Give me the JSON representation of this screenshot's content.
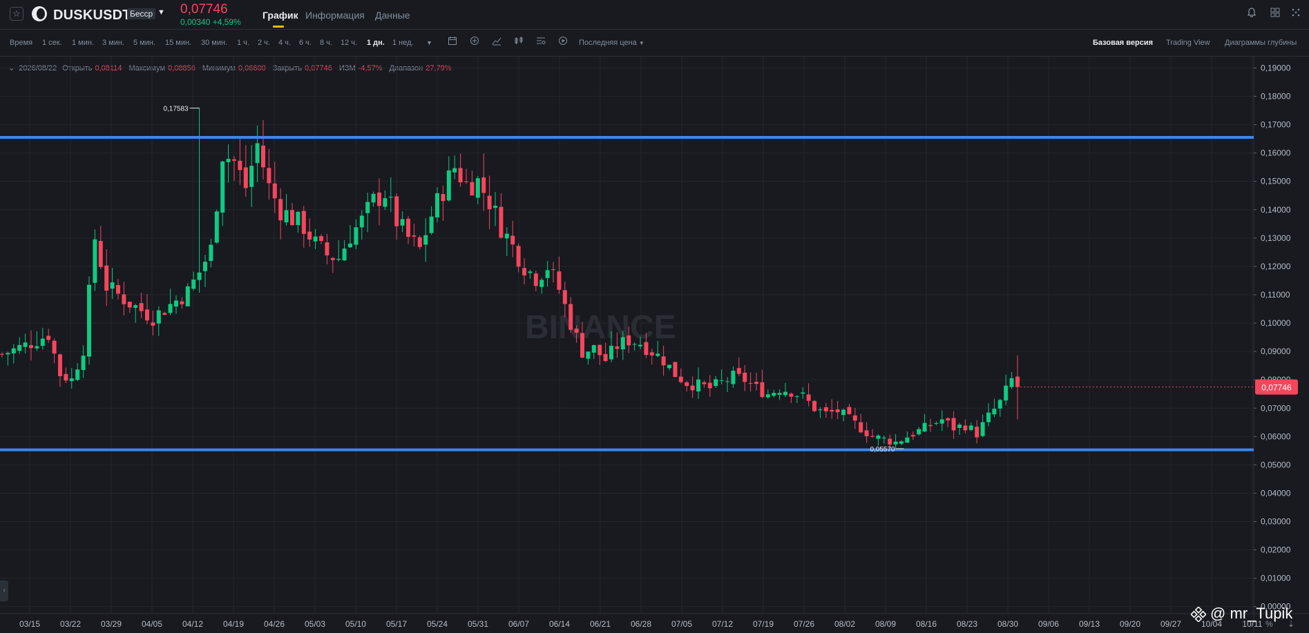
{
  "header": {
    "symbol": "DUSKUSDT",
    "contract_type": "Бесср",
    "last_price": "0,07746",
    "change": "0,00340 +4,59%",
    "tabs": [
      {
        "label": "График",
        "active": true
      },
      {
        "label": "Информация",
        "active": false
      },
      {
        "label": "Данные",
        "active": false
      }
    ],
    "icons": [
      "star-icon",
      "bell-icon",
      "grid-icon",
      "more-icon"
    ]
  },
  "toolbar": {
    "time_label": "Время",
    "timeframes": [
      "1 сек.",
      "1 мин.",
      "3 мин.",
      "5 мин.",
      "15 мин.",
      "30 мин.",
      "1 ч.",
      "2 ч.",
      "4 ч.",
      "6 ч.",
      "8 ч.",
      "12 ч.",
      "1 дн.",
      "1 нед."
    ],
    "active_timeframe": "1 дн.",
    "price_type": "Последняя цена",
    "views": [
      "Базовая версия",
      "Trading View",
      "Диаграммы глубины"
    ],
    "active_view": "Базовая версия"
  },
  "ohlc": {
    "date": "2026/08/22",
    "open_label": "Открыть",
    "open": "0,08114",
    "high_label": "Максимум",
    "high": "0,08856",
    "low_label": "Минимум",
    "low": "0,06600",
    "close_label": "Закрыть",
    "close": "0,07746",
    "change_label": "ИЗМ",
    "change": "-4,57%",
    "range_label": "Диапазон",
    "range": "27,79%"
  },
  "chart_data": {
    "type": "candlestick",
    "x_ticks": [
      "03/15",
      "03/22",
      "03/29",
      "04/05",
      "04/12",
      "04/19",
      "04/26",
      "05/03",
      "05/10",
      "05/17",
      "05/24",
      "05/31",
      "06/07",
      "06/14",
      "06/21",
      "06/28",
      "07/05",
      "07/12",
      "07/19",
      "07/26",
      "08/02",
      "08/09",
      "08/16",
      "08/23",
      "08/30",
      "09/06",
      "09/13",
      "09/20",
      "09/27",
      "10/04",
      "10/11"
    ],
    "y_ticks": [
      "0,19000",
      "0,18000",
      "0,17000",
      "0,16000",
      "0,15000",
      "0,14000",
      "0,13000",
      "0,12000",
      "0,11000",
      "0,10000",
      "0,09000",
      "0,08000",
      "0,07000",
      "0,06000",
      "0,05000",
      "0,04000",
      "0,03000",
      "0,02000",
      "0,01000",
      "0,00000"
    ],
    "y_values": [
      0.19,
      0.18,
      0.17,
      0.16,
      0.15,
      0.14,
      0.13,
      0.12,
      0.11,
      0.1,
      0.09,
      0.08,
      0.07,
      0.06,
      0.05,
      0.04,
      0.03,
      0.02,
      0.01,
      0.0
    ],
    "ylim": [
      -0.0025,
      0.194
    ],
    "first_candle_day": 0,
    "last_candle_day": 162,
    "up_color": "#0ecb81",
    "down_color": "#f6465d",
    "close_points": [
      [
        0,
        0.089
      ],
      [
        5,
        0.093
      ],
      [
        8,
        0.096
      ],
      [
        10,
        0.082
      ],
      [
        12,
        0.08
      ],
      [
        14,
        0.091
      ],
      [
        16,
        0.13
      ],
      [
        18,
        0.113
      ],
      [
        22,
        0.107
      ],
      [
        26,
        0.102
      ],
      [
        30,
        0.108
      ],
      [
        32,
        0.111
      ],
      [
        34,
        0.118
      ],
      [
        36,
        0.126
      ],
      [
        38,
        0.16
      ],
      [
        40,
        0.157
      ],
      [
        42,
        0.148
      ],
      [
        44,
        0.163
      ],
      [
        46,
        0.148
      ],
      [
        48,
        0.14
      ],
      [
        50,
        0.137
      ],
      [
        52,
        0.134
      ],
      [
        54,
        0.128
      ],
      [
        56,
        0.124
      ],
      [
        58,
        0.123
      ],
      [
        60,
        0.131
      ],
      [
        62,
        0.136
      ],
      [
        64,
        0.143
      ],
      [
        66,
        0.146
      ],
      [
        68,
        0.136
      ],
      [
        70,
        0.13
      ],
      [
        72,
        0.126
      ],
      [
        74,
        0.138
      ],
      [
        76,
        0.147
      ],
      [
        78,
        0.155
      ],
      [
        80,
        0.149
      ],
      [
        82,
        0.15
      ],
      [
        84,
        0.143
      ],
      [
        86,
        0.134
      ],
      [
        88,
        0.127
      ],
      [
        90,
        0.12
      ],
      [
        92,
        0.116
      ],
      [
        94,
        0.12
      ],
      [
        96,
        0.112
      ],
      [
        98,
        0.1
      ],
      [
        100,
        0.09
      ],
      [
        102,
        0.091
      ],
      [
        104,
        0.087
      ],
      [
        106,
        0.092
      ],
      [
        108,
        0.094
      ],
      [
        110,
        0.093
      ],
      [
        112,
        0.09
      ],
      [
        114,
        0.087
      ],
      [
        116,
        0.082
      ],
      [
        118,
        0.079
      ],
      [
        120,
        0.078
      ],
      [
        122,
        0.077
      ],
      [
        124,
        0.079
      ],
      [
        126,
        0.081
      ],
      [
        128,
        0.08
      ],
      [
        130,
        0.077
      ],
      [
        132,
        0.075
      ],
      [
        134,
        0.077
      ],
      [
        136,
        0.076
      ],
      [
        138,
        0.074
      ],
      [
        140,
        0.07
      ],
      [
        142,
        0.068
      ],
      [
        144,
        0.069
      ],
      [
        146,
        0.066
      ],
      [
        148,
        0.063
      ],
      [
        150,
        0.06
      ],
      [
        152,
        0.059
      ],
      [
        154,
        0.058
      ],
      [
        156,
        0.06
      ],
      [
        158,
        0.062
      ],
      [
        160,
        0.064
      ],
      [
        162,
        0.066
      ],
      [
        164,
        0.063
      ],
      [
        166,
        0.064
      ],
      [
        168,
        0.061
      ],
      [
        170,
        0.067
      ],
      [
        172,
        0.072
      ],
      [
        174,
        0.08
      ],
      [
        175,
        0.0775
      ]
    ],
    "annotations": [
      {
        "label": "0,17583",
        "value": 0.17583,
        "day": 34
      },
      {
        "label": "0,05570",
        "value": 0.0557,
        "day": 154
      }
    ],
    "horizontal_lines": [
      {
        "value": 0.1655,
        "color": "#3a87f0"
      },
      {
        "value": 0.0553,
        "color": "#3a87f0"
      }
    ],
    "current_price_label": "0,07746",
    "current_price": 0.07746,
    "watermark": "BINANCE"
  },
  "footer": {
    "watermark_text": "@ mr_Tupik",
    "axis_controls": [
      "%",
      "⇣"
    ]
  }
}
